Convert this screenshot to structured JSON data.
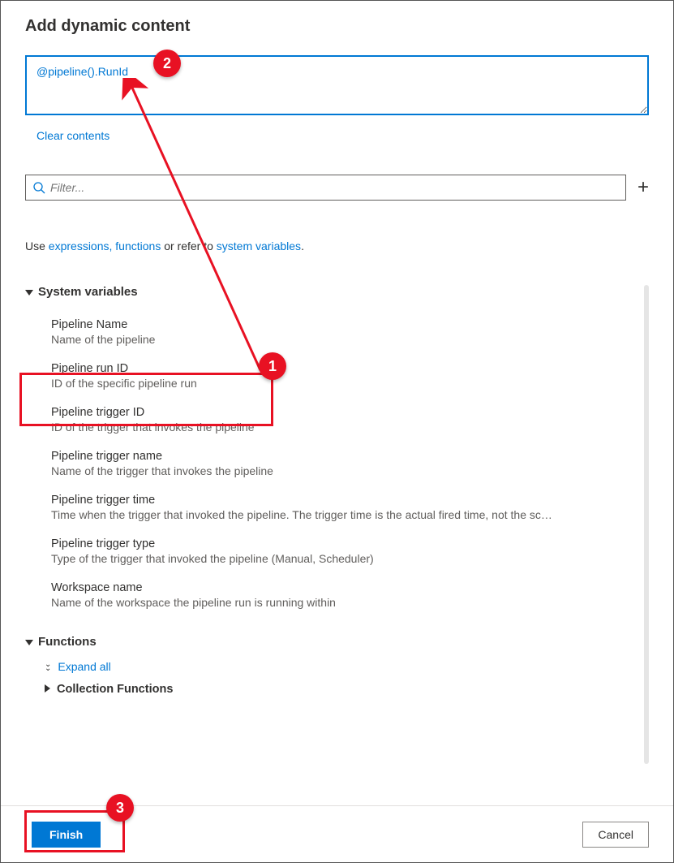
{
  "title": "Add dynamic content",
  "expression": "@pipeline().RunId",
  "clear_label": "Clear contents",
  "filter_placeholder": "Filter...",
  "help": {
    "prefix": "Use ",
    "link1": "expressions, functions",
    "mid": " or refer to ",
    "link2": "system variables",
    "suffix": "."
  },
  "sections": {
    "sysvars": {
      "header": "System variables",
      "items": [
        {
          "name": "Pipeline Name",
          "desc": "Name of the pipeline"
        },
        {
          "name": "Pipeline run ID",
          "desc": "ID of the specific pipeline run"
        },
        {
          "name": "Pipeline trigger ID",
          "desc": "ID of the trigger that invokes the pipeline"
        },
        {
          "name": "Pipeline trigger name",
          "desc": "Name of the trigger that invokes the pipeline"
        },
        {
          "name": "Pipeline trigger time",
          "desc": "Time when the trigger that invoked the pipeline. The trigger time is the actual fired time, not the sc…"
        },
        {
          "name": "Pipeline trigger type",
          "desc": "Type of the trigger that invoked the pipeline (Manual, Scheduler)"
        },
        {
          "name": "Workspace name",
          "desc": "Name of the workspace the pipeline run is running within"
        }
      ]
    },
    "functions": {
      "header": "Functions",
      "expand_all": "Expand all",
      "sub": "Collection Functions"
    }
  },
  "footer": {
    "finish": "Finish",
    "cancel": "Cancel"
  },
  "callouts": {
    "c1": "1",
    "c2": "2",
    "c3": "3"
  }
}
